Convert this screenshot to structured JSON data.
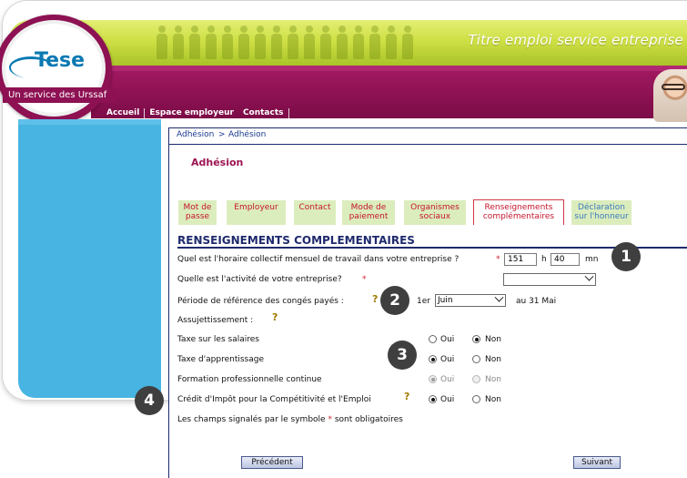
{
  "brand": {
    "product_title": "Titre emploi service entreprise",
    "logo_name": "Tese",
    "logo_tagline": "Un service des Urssaf"
  },
  "nav": [
    "Accueil",
    "Espace employeur",
    "Contacts"
  ],
  "breadcrumb": {
    "parent": "Adhésion",
    "separator": ">",
    "current": "Adhésion"
  },
  "page_title": "Adhésion",
  "tabs": [
    {
      "label": "Mot de passe",
      "state": "inactive"
    },
    {
      "label": "Employeur",
      "state": "inactive"
    },
    {
      "label": "Contact",
      "state": "inactive"
    },
    {
      "label": "Mode de paiement",
      "state": "inactive"
    },
    {
      "label": "Organismes sociaux",
      "state": "inactive"
    },
    {
      "label": "Renseignements complémentaires",
      "state": "active"
    },
    {
      "label": "Déclaration sur l'honneur",
      "state": "next"
    }
  ],
  "section_title": "RENSEIGNEMENTS COMPLEMENTAIRES",
  "form": {
    "horaire": {
      "label": "Quel est l'horaire collectif mensuel de travail dans votre entreprise ?",
      "required_mark": "*",
      "hours_value": "151",
      "hours_unit": "h",
      "minutes_value": "40",
      "minutes_unit": "mn"
    },
    "activite": {
      "label": "Quelle est l'activité de votre entreprise?",
      "required_mark": "*",
      "selected": ""
    },
    "conges": {
      "label": "Période de référence des congés payés  :",
      "prefix": "1er",
      "selected": "Juin",
      "suffix": "au 31 Mai"
    },
    "assujettissement_label": "Assujettissement  :",
    "taxes": [
      {
        "label": "Taxe sur les salaires",
        "yes": "Oui",
        "no": "Non",
        "value": "Non",
        "disabled": false
      },
      {
        "label": "Taxe d'apprentissage",
        "yes": "Oui",
        "no": "Non",
        "value": "Oui",
        "disabled": false
      },
      {
        "label": "Formation professionnelle continue",
        "yes": "Oui",
        "no": "Non",
        "value": "Oui",
        "disabled": true
      },
      {
        "label": "Crédit d'Impôt pour la Compétitivité et l'Emploi",
        "yes": "Oui",
        "no": "Non",
        "value": "Oui",
        "disabled": false
      }
    ],
    "required_note": {
      "before": "Les champs signalés par le symbole",
      "mark": "*",
      "after": "sont obligatoires"
    }
  },
  "buttons": {
    "previous": "Précédent",
    "next": "Suivant"
  },
  "callouts": [
    "1",
    "2",
    "3",
    "4"
  ],
  "colors": {
    "brand_magenta": "#8d1153",
    "header_green": "#cfe045",
    "sidebar_blue": "#48b4e2",
    "navy": "#1f2a6d",
    "required_red": "#d21c2c",
    "tab_green": "#dcedbd"
  },
  "icons": {
    "help": "help-lightbulb-icon",
    "dropdown": "chevron-down-icon"
  }
}
